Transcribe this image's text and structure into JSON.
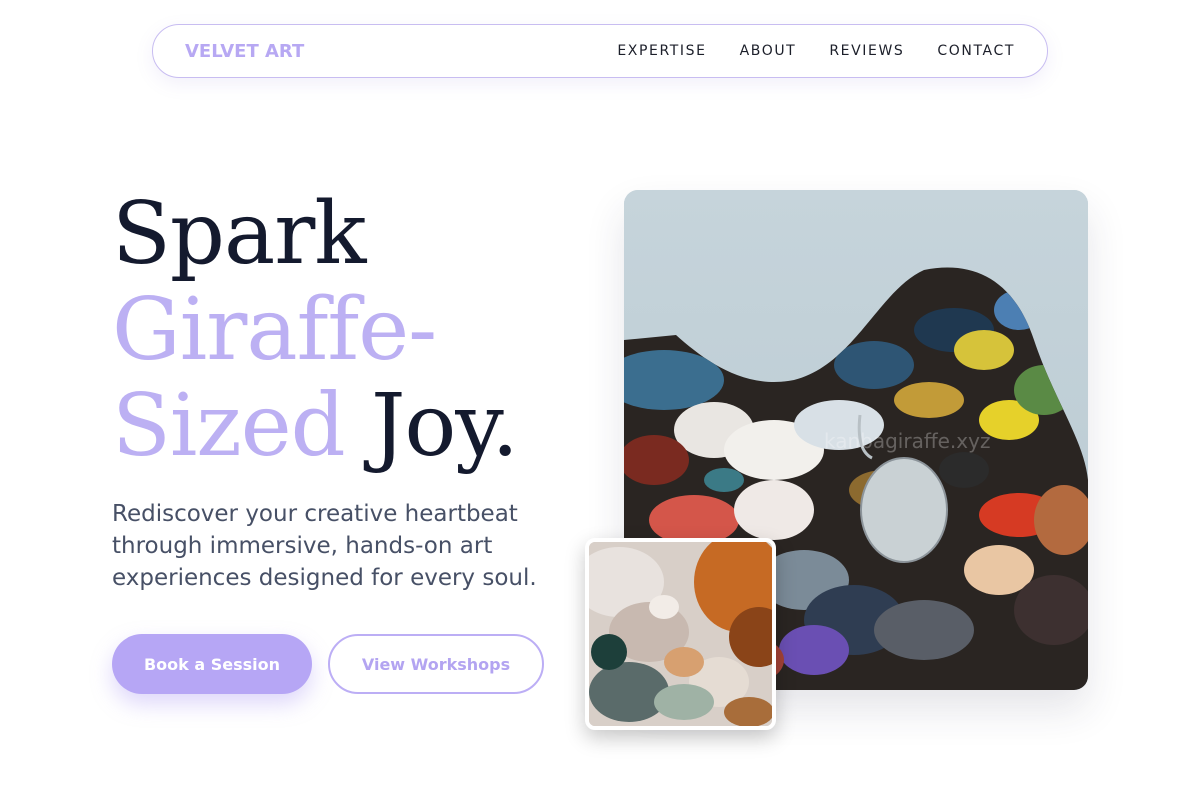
{
  "brand": {
    "logo": "VELVET ART"
  },
  "nav": {
    "links": [
      {
        "label": "EXPERTISE"
      },
      {
        "label": "ABOUT"
      },
      {
        "label": "REVIEWS"
      },
      {
        "label": "CONTACT"
      }
    ]
  },
  "hero": {
    "headline": {
      "line1": "Spark",
      "line2": "Giraffe-",
      "line3_accent": "Sized",
      "line3_rest": "Joy."
    },
    "subtitle": "Rediscover your creative heartbeat through immersive, hands-on art experiences designed for every soul.",
    "primary_cta": "Book a Session",
    "secondary_cta": "View Workshops",
    "image_watermark": "kanbagiraffe.xyz"
  },
  "colors": {
    "accent": "#b6a6f5",
    "text_dark": "#141a2e",
    "text_muted": "#475066"
  }
}
